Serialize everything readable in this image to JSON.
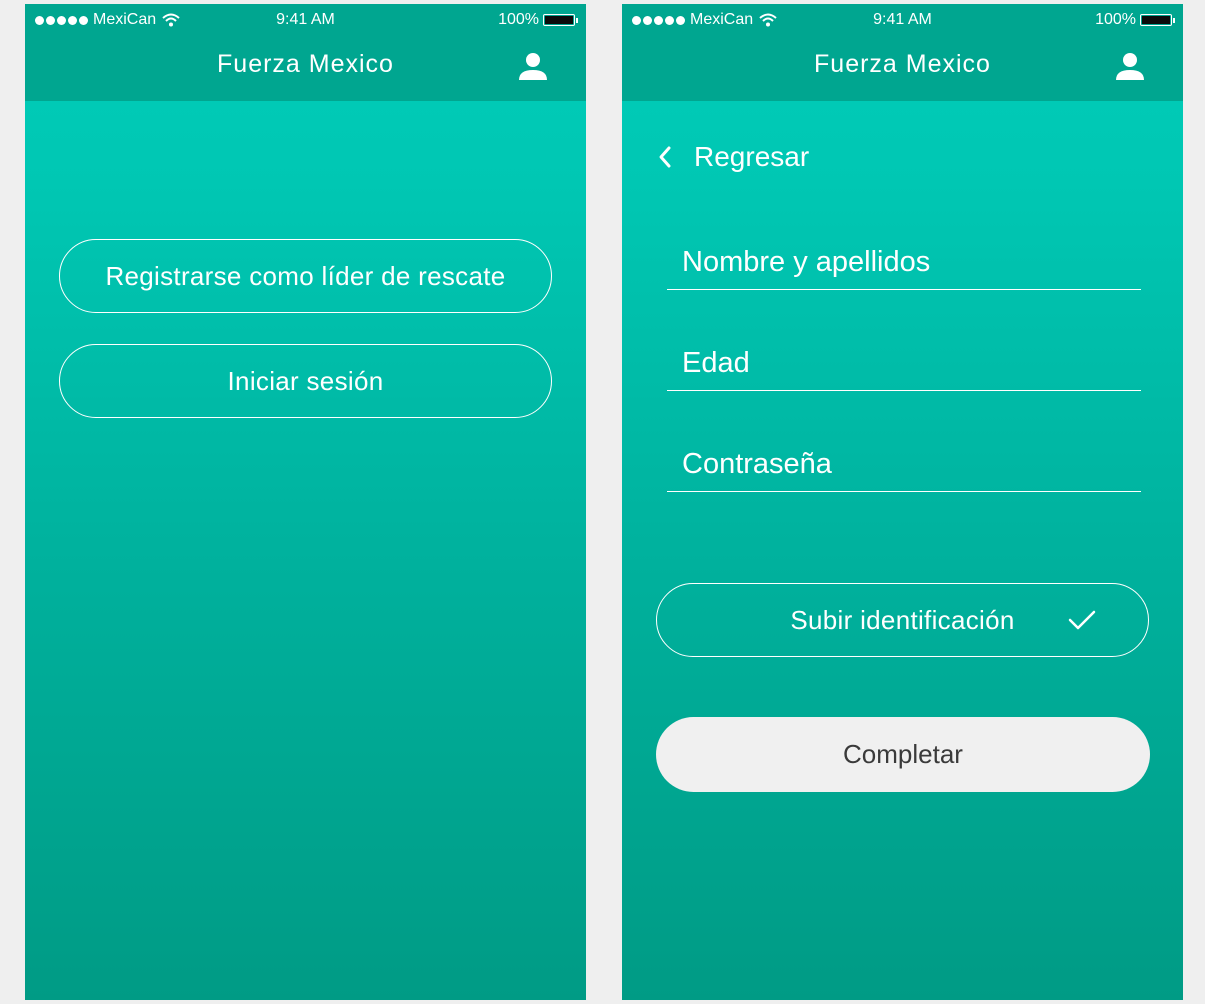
{
  "status_bar": {
    "carrier": "MexiCan",
    "time": "9:41 AM",
    "battery": "100%"
  },
  "app_title": "Fuerza Mexico",
  "icons": {
    "profile": "user-icon",
    "wifi": "wifi-icon",
    "back": "chevron-left-icon",
    "check": "check-icon"
  },
  "colors": {
    "navbar": "#00a690",
    "gradient_top": "#00cdb9",
    "gradient_bottom": "#009b85",
    "primary_button": "#f0f0f0"
  },
  "screen_welcome": {
    "register_button": "Registrarse como líder de rescate",
    "login_button": "Iniciar sesión"
  },
  "screen_register": {
    "back_label": "Regresar",
    "fields": [
      {
        "placeholder": "Nombre y apellidos"
      },
      {
        "placeholder": "Edad"
      },
      {
        "placeholder": "Contraseña"
      }
    ],
    "upload_button": "Subir identificación",
    "upload_done": true,
    "complete_button": "Completar"
  }
}
